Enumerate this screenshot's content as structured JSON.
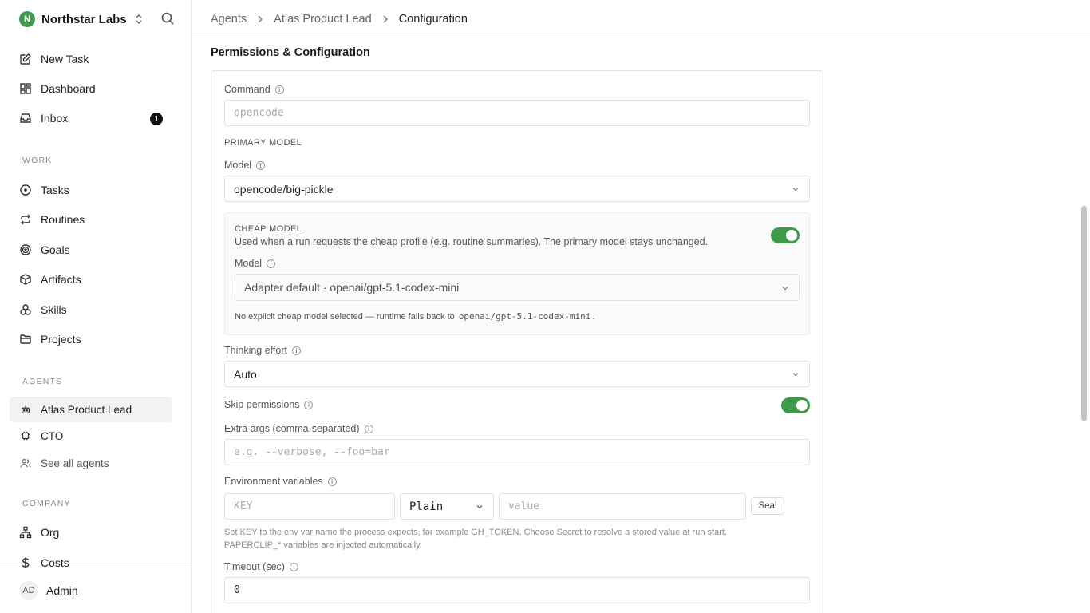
{
  "workspace": {
    "initial": "N",
    "name": "Northstar Labs"
  },
  "sidebar": {
    "top_items": [
      {
        "label": "New Task",
        "icon": "edit-icon"
      },
      {
        "label": "Dashboard",
        "icon": "dashboard-icon"
      },
      {
        "label": "Inbox",
        "icon": "inbox-icon",
        "badge": "1"
      }
    ],
    "work_label": "WORK",
    "work_items": [
      {
        "label": "Tasks",
        "icon": "circle-dot-icon"
      },
      {
        "label": "Routines",
        "icon": "repeat-icon"
      },
      {
        "label": "Goals",
        "icon": "target-icon"
      },
      {
        "label": "Artifacts",
        "icon": "box-icon"
      },
      {
        "label": "Skills",
        "icon": "boxes-icon"
      },
      {
        "label": "Projects",
        "icon": "folder-icon"
      }
    ],
    "agents_label": "AGENTS",
    "agent_items": [
      {
        "label": "Atlas Product Lead",
        "icon": "bot-icon",
        "active": true
      },
      {
        "label": "CTO",
        "icon": "cpu-icon"
      },
      {
        "label": "See all agents",
        "icon": "users-icon"
      }
    ],
    "company_label": "COMPANY",
    "company_items": [
      {
        "label": "Org",
        "icon": "org-chart-icon"
      },
      {
        "label": "Costs",
        "icon": "dollar-icon"
      }
    ],
    "user": {
      "initials": "AD",
      "name": "Admin"
    }
  },
  "breadcrumb": [
    "Agents",
    "Atlas Product Lead",
    "Configuration"
  ],
  "main": {
    "section_title": "Permissions & Configuration",
    "command": {
      "label": "Command",
      "placeholder": "opencode"
    },
    "primary_model_heading": "PRIMARY MODEL",
    "model": {
      "label": "Model",
      "value": "opencode/big-pickle"
    },
    "cheap_model": {
      "heading": "CHEAP MODEL",
      "description": "Used when a run requests the cheap profile (e.g. routine summaries). The primary model stays unchanged.",
      "enabled": true,
      "model_label": "Model",
      "model_value": "Adapter default · openai/gpt-5.1-codex-mini",
      "note_prefix": "No explicit cheap model selected — runtime falls back to",
      "note_code": "openai/gpt-5.1-codex-mini",
      "note_suffix": "."
    },
    "thinking_effort": {
      "label": "Thinking effort",
      "value": "Auto"
    },
    "skip_permissions": {
      "label": "Skip permissions",
      "enabled": true
    },
    "extra_args": {
      "label": "Extra args (comma-separated)",
      "placeholder": "e.g. --verbose, --foo=bar"
    },
    "env_vars": {
      "label": "Environment variables",
      "key_placeholder": "KEY",
      "mode": "Plain",
      "value_placeholder": "value",
      "seal_label": "Seal",
      "help": "Set KEY to the env var name the process expects, for example GH_TOKEN. Choose Secret to resolve a stored value at run start. PAPERCLIP_* variables are injected automatically."
    },
    "timeout": {
      "label": "Timeout (sec)",
      "value": "0"
    }
  },
  "colors": {
    "accent_green": "#3d9a48",
    "badge": "#111111",
    "border": "#e0e0e0"
  }
}
